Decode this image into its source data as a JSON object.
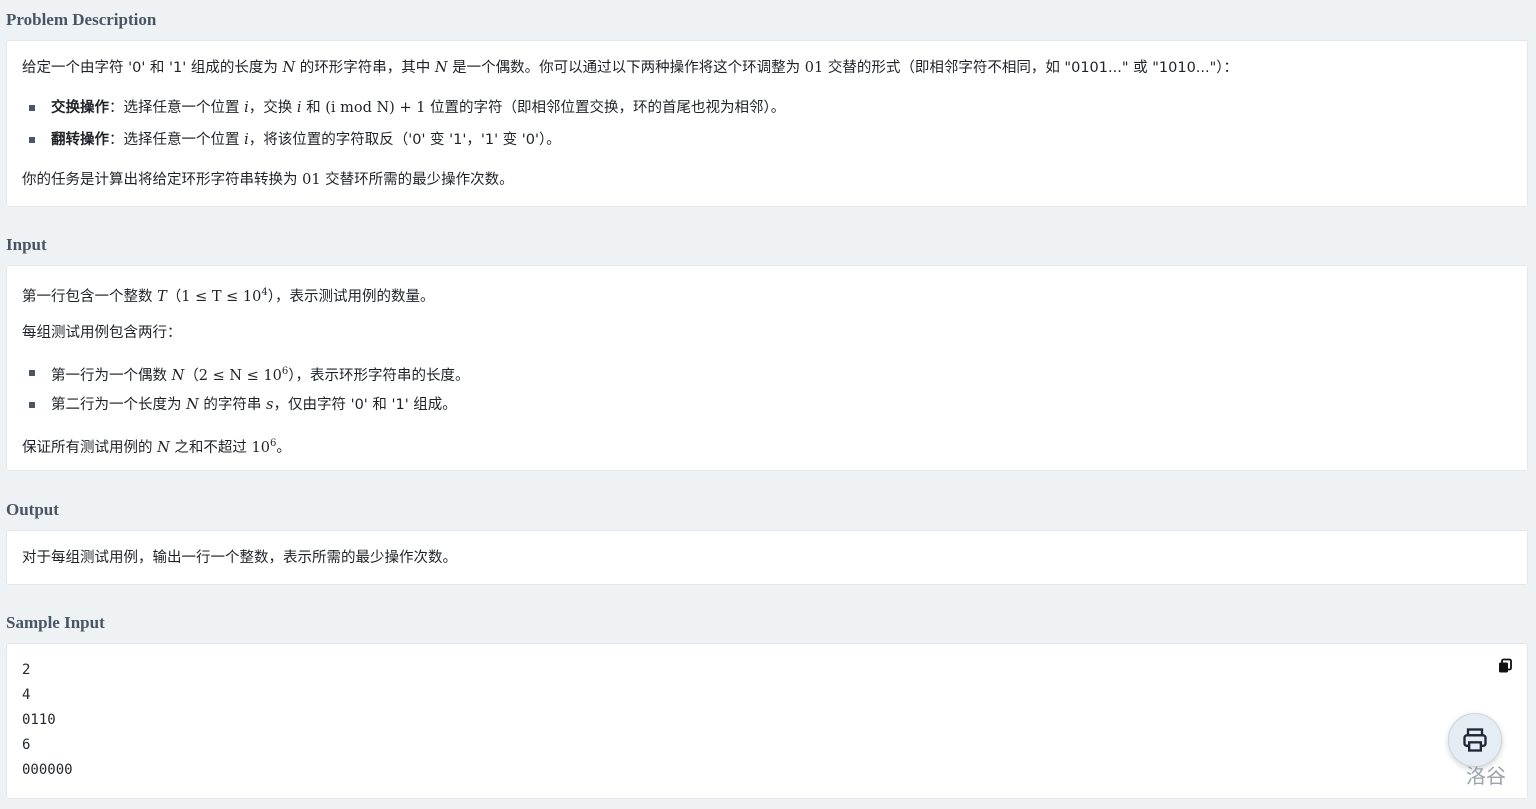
{
  "sections": {
    "description": {
      "title": "Problem Description",
      "p1_a": "给定一个由字符 '0' 和 '1' 组成的长度为 ",
      "p1_N1": "N",
      "p1_b": " 的环形字符串，其中 ",
      "p1_N2": "N",
      "p1_c": " 是一个偶数。你可以通过以下两种操作将这个环调整为 ",
      "p1_01": "01",
      "p1_d": " 交替的形式（即相邻字符不相同，如 \"0101...\" 或 \"1010...\"）：",
      "li1_bold": "交换操作",
      "li1_a": "：选择任意一个位置 ",
      "li1_i": "i",
      "li1_b": "，交换 ",
      "li1_i2": "i",
      "li1_c": " 和 ",
      "li1_expr": "(i mod N) + 1",
      "li1_d": " 位置的字符（即相邻位置交换，环的首尾也视为相邻）。",
      "li2_bold": "翻转操作",
      "li2_a": "：选择任意一个位置 ",
      "li2_i": "i",
      "li2_b": "，将该位置的字符取反（'0' 变 '1'，'1' 变 '0'）。",
      "p2_a": "你的任务是计算出将给定环形字符串转换为 ",
      "p2_01": "01",
      "p2_b": " 交替环所需的最少操作次数。"
    },
    "input": {
      "title": "Input",
      "p1_a": "第一行包含一个整数 ",
      "p1_T": "T",
      "p1_expr_open": "（",
      "p1_expr": "1 ≤ T ≤ 10",
      "p1_exp": "4",
      "p1_b": "），表示测试用例的数量。",
      "p2": "每组测试用例包含两行：",
      "li1_a": "第一行为一个偶数 ",
      "li1_N": "N",
      "li1_open": "（",
      "li1_expr": "2 ≤ N ≤ 10",
      "li1_exp": "6",
      "li1_b": "），表示环形字符串的长度。",
      "li2_a": "第二行为一个长度为 ",
      "li2_N": "N",
      "li2_b": " 的字符串 ",
      "li2_s": "s",
      "li2_c": "，仅由字符 '0' 和 '1' 组成。",
      "p3_a": "保证所有测试用例的 ",
      "p3_N": "N",
      "p3_b": " 之和不超过 ",
      "p3_10": "10",
      "p3_exp": "6",
      "p3_c": "。"
    },
    "output": {
      "title": "Output",
      "p1": "对于每组测试用例，输出一行一个整数，表示所需的最少操作次数。"
    },
    "sample_input": {
      "title": "Sample Input",
      "lines": [
        "2",
        "4",
        "0110",
        "6",
        "000000"
      ]
    }
  },
  "watermark": "洛谷",
  "icons": {
    "copy": "copy-icon",
    "print": "printer-icon"
  }
}
